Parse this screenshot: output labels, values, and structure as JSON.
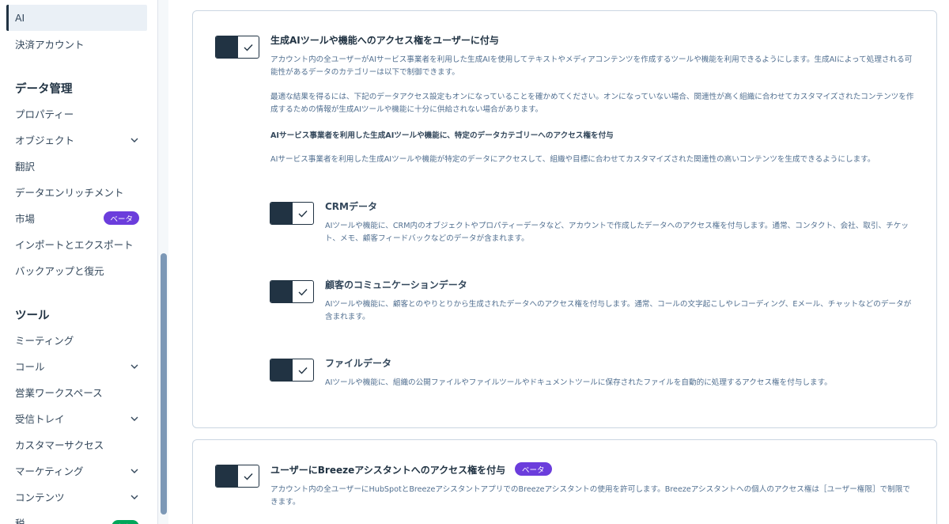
{
  "sidebar": {
    "items": [
      {
        "label": "AI"
      },
      {
        "label": "決済アカウント"
      },
      {
        "label": "プロパティー"
      },
      {
        "label": "オブジェクト"
      },
      {
        "label": "翻訳"
      },
      {
        "label": "データエンリッチメント"
      },
      {
        "label": "市場",
        "badge": "ベータ"
      },
      {
        "label": "インポートとエクスポート"
      },
      {
        "label": "バックアップと復元"
      },
      {
        "label": "ミーティング"
      },
      {
        "label": "コール"
      },
      {
        "label": "営業ワークスペース"
      },
      {
        "label": "受信トレイ"
      },
      {
        "label": "カスタマーサクセス"
      },
      {
        "label": "マーケティング"
      },
      {
        "label": "コンテンツ"
      },
      {
        "label": "税",
        "badge": "新規"
      }
    ],
    "sections": {
      "data": "データ管理",
      "tools": "ツール"
    }
  },
  "access_card": {
    "title": "生成AIツールや機能へのアクセス権をユーザーに付与",
    "desc_1": "アカウント内の全ユーザーがAIサービス事業者を利用した生成AIを使用してテキストやメディアコンテンツを作成するツールや機能を利用できるようにします。生成AIによって処理される可能性があるデータのカテゴリーは以下で制御できます。",
    "desc_2": "最適な結果を得るには、下記のデータアクセス設定もオンになっていることを確かめてください。オンになっていない場合、関連性が高く組織に合わせてカスタマイズされたコンテンツを作成するための情報が生成AIツールや機能に十分に供給されない場合があります。",
    "subheading": "AIサービス事業者を利用した生成AIツールや機能に、特定のデータカテゴリーへのアクセス権を付与",
    "desc_3": "AIサービス事業者を利用した生成AIツールや機能が特定のデータにアクセスして、組織や目標に合わせてカスタマイズされた関連性の高いコンテンツを生成できるようにします。",
    "categories": [
      {
        "title": "CRMデータ",
        "desc": "AIツールや機能に、CRM内のオブジェクトやプロパティーデータなど、アカウントで作成したデータへのアクセス権を付与します。通常、コンタクト、会社、取引、チケット、メモ、顧客フィードバックなどのデータが含まれます。"
      },
      {
        "title": "顧客のコミュニケーションデータ",
        "desc": "AIツールや機能に、顧客とのやりとりから生成されたデータへのアクセス権を付与します。通常、コールの文字起こしやレコーディング、Eメール、チャットなどのデータが含まれます。"
      },
      {
        "title": "ファイルデータ",
        "desc": "AIツールや機能に、組織の公開ファイルやファイルツールやドキュメントツールに保存されたファイルを自動的に処理するアクセス権を付与します。"
      }
    ]
  },
  "breeze_card": {
    "title": "ユーザーにBreezeアシスタントへのアクセス権を付与",
    "badge": "ベータ",
    "desc": "アカウント内の全ユーザーにHubSpotとBreezeアシスタントアプリでのBreezeアシスタントの使用を許可します。Breezeアシスタントへの個人のアクセス権は［ユーザー権限］で制限できます。"
  }
}
